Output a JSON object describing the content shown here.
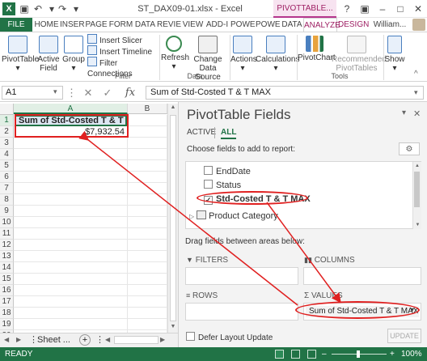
{
  "window": {
    "title": "ST_DAX09-01.xlsx - Excel",
    "app_icon": "X",
    "context_tab_group": "PIVOTTABLE...",
    "help_button": "?",
    "restore_glyph": "▣",
    "minimize_glyph": "–",
    "maximize_glyph": "□",
    "close_glyph": "✕",
    "save_glyph": "▣",
    "undo_glyph": "↶",
    "redo_glyph": "↷",
    "qat_more_glyph": "▾"
  },
  "ribbon_tabs": [
    "FILE",
    "HOME",
    "INSER",
    "PAGE",
    "FORM",
    "DATA",
    "REVIE",
    "VIEW",
    "ADD-I",
    "POWE",
    "POWE",
    "DATA",
    "ANALYZE",
    "DESIGN"
  ],
  "user_name": "William...",
  "ribbon": {
    "pivottable": "PivotTable",
    "active_field": "Active Field",
    "group": "Group",
    "insert_slicer": "Insert Slicer",
    "insert_timeline": "Insert Timeline",
    "filter_connections": "Filter Connections",
    "filter_group": "Filter",
    "refresh": "Refresh",
    "change_data_source": "Change Data Source",
    "data_group": "Data",
    "actions": "Actions",
    "calculations": "Calculations",
    "pivotchart": "PivotChart",
    "recommended_pivottables": "Recommended PivotTables",
    "tools_group": "Tools",
    "show": "Show",
    "dropdown_glyph": "▾",
    "collapse_glyph": "^"
  },
  "formula_bar": {
    "name_box": "A1",
    "name_box_arrow": "▾",
    "dots": "⋮",
    "cancel_glyph": "✕",
    "enter_glyph": "✓",
    "fx_label": "fx",
    "formula": "Sum of Std-Costed T & T MAX",
    "expand_glyph": "▾"
  },
  "grid": {
    "columns": [
      "A",
      "B"
    ],
    "rows": [
      "1",
      "2",
      "3",
      "4",
      "5",
      "6",
      "7",
      "8",
      "9",
      "10",
      "11",
      "12",
      "13",
      "14",
      "15",
      "16",
      "17",
      "18",
      "19",
      "20"
    ],
    "a1": "Sum of Std-Costed T & T MAX",
    "a2": "$7,932.54"
  },
  "sheet_bar": {
    "prev": "◀",
    "next": "▶",
    "sheet_name": "Sheet ...",
    "add": "+",
    "more": "⋮",
    "scroll_left": "◀",
    "scroll_right": "▶"
  },
  "scrollbar": {
    "up": "▲",
    "down": "▼"
  },
  "pivot_pane": {
    "title": "PivotTable Fields",
    "collapse_glyph": "▾",
    "close_glyph": "✕",
    "tab_active": "ACTIVE",
    "tab_all": "ALL",
    "choose_label": "Choose fields to add to report:",
    "settings_glyph": "⚙",
    "fields": [
      {
        "label": "EndDate",
        "checked": false
      },
      {
        "label": "Status",
        "checked": false
      },
      {
        "label": "Std-Costed T & T MAX",
        "checked": true
      }
    ],
    "check_glyph": "✓",
    "group_expand": "▷",
    "group_label": "Product Category",
    "drag_label": "Drag fields between areas below:",
    "filters_label": "FILTERS",
    "columns_label": "COLUMNS",
    "rows_label": "ROWS",
    "values_label": "VALUES",
    "sigma_glyph": "Σ",
    "values_chip": "Sum of Std-Costed T & T MAX",
    "chip_arrow": "▾",
    "defer_label": "Defer Layout Update",
    "update_button": "UPDATE"
  },
  "status_bar": {
    "ready": "READY",
    "zoom": "100%",
    "minus": "–",
    "plus": "+"
  },
  "colors": {
    "excel_green": "#217346",
    "pivot_magenta": "#9e1f63",
    "annotation_red": "#e02020"
  }
}
